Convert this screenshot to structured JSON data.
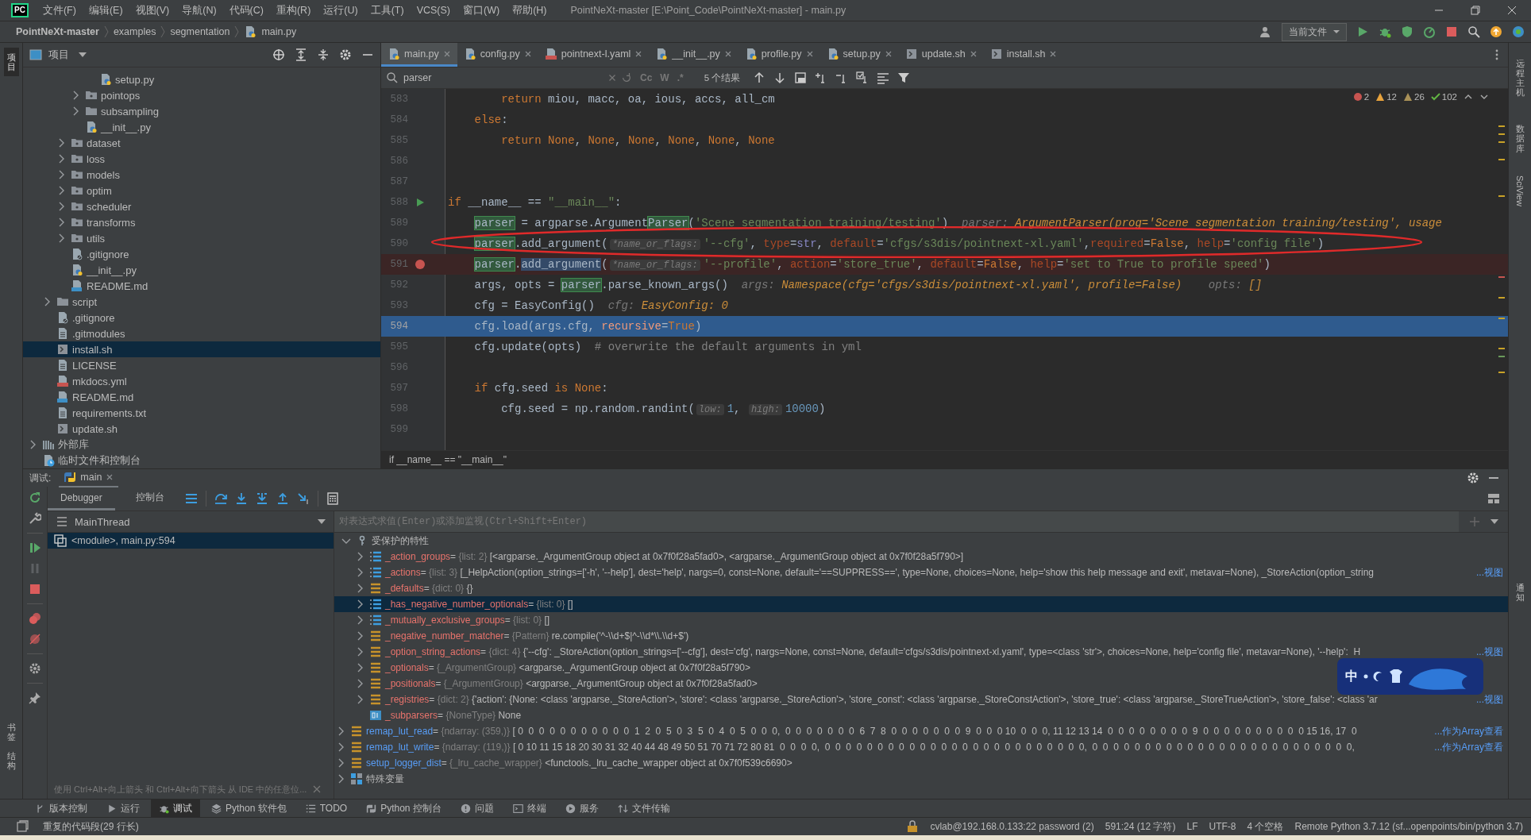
{
  "window": {
    "logo": "PC",
    "title": "PointNeXt-master [E:\\Point_Code\\PointNeXt-master] - main.py"
  },
  "menu": [
    "文件(F)",
    "编辑(E)",
    "视图(V)",
    "导航(N)",
    "代码(C)",
    "重构(R)",
    "运行(U)",
    "工具(T)",
    "VCS(S)",
    "窗口(W)",
    "帮助(H)"
  ],
  "breadcrumb": [
    "PointNeXt-master",
    "examples",
    "segmentation",
    "main.py"
  ],
  "run_config": "当前文件",
  "left_strip": [
    {
      "label": "项目",
      "selected": true
    },
    {
      "label": "书签",
      "selected": false
    },
    {
      "label": "结构",
      "selected": false
    }
  ],
  "right_strip": [
    "远程主机",
    "数据库",
    "SciView",
    "通知"
  ],
  "project": {
    "title": "项目",
    "tree": [
      {
        "children": [
          {
            "children": [
              {
                "children": [
                  {
                    "children": [
                      {
                        "label": "setup.py",
                        "kind": "python",
                        "selected": false
                      }
                    ]
                  },
                  {
                    "label": "pointops",
                    "kind": "package",
                    "expanded": false,
                    "selected": false
                  },
                  {
                    "label": "subsampling",
                    "kind": "folder",
                    "expanded": false,
                    "selected": false
                  },
                  {
                    "label": "__init__.py",
                    "kind": "python",
                    "selected": false
                  }
                ]
              },
              {
                "label": "dataset",
                "kind": "package",
                "expanded": false,
                "selected": false
              },
              {
                "label": "loss",
                "kind": "package",
                "expanded": false,
                "selected": false
              },
              {
                "label": "models",
                "kind": "package",
                "expanded": false,
                "selected": false
              },
              {
                "label": "optim",
                "kind": "package",
                "expanded": false,
                "selected": false
              },
              {
                "label": "scheduler",
                "kind": "package",
                "expanded": false,
                "selected": false
              },
              {
                "label": "transforms",
                "kind": "package",
                "expanded": false,
                "selected": false
              },
              {
                "label": "utils",
                "kind": "package",
                "expanded": false,
                "selected": false
              },
              {
                "label": ".gitignore",
                "kind": "gitignore",
                "selected": false
              },
              {
                "label": "__init__.py",
                "kind": "python",
                "selected": false
              },
              {
                "label": "README.md",
                "kind": "md",
                "selected": false
              }
            ]
          },
          {
            "label": "script",
            "kind": "folder",
            "expanded": false,
            "selected": false
          },
          {
            "label": ".gitignore",
            "kind": "gitignore",
            "selected": false
          },
          {
            "label": ".gitmodules",
            "kind": "file",
            "selected": false
          },
          {
            "label": "install.sh",
            "kind": "sh",
            "selected": true
          },
          {
            "label": "LICENSE",
            "kind": "file",
            "selected": false
          },
          {
            "label": "mkdocs.yml",
            "kind": "yml",
            "selected": false
          },
          {
            "label": "README.md",
            "kind": "md",
            "selected": false
          },
          {
            "label": "requirements.txt",
            "kind": "file",
            "selected": false
          },
          {
            "label": "update.sh",
            "kind": "sh",
            "selected": false
          }
        ]
      },
      {
        "label": "外部库",
        "kind": "lib",
        "expanded": false,
        "selected": false
      },
      {
        "label": "临时文件和控制台",
        "kind": "scratch",
        "selected": false
      }
    ]
  },
  "editor": {
    "tabs": [
      {
        "label": "main.py",
        "kind": "python",
        "selected": true
      },
      {
        "label": "config.py",
        "kind": "python",
        "selected": false
      },
      {
        "label": "pointnext-l.yaml",
        "kind": "yml",
        "selected": false
      },
      {
        "label": "__init__.py",
        "kind": "python",
        "selected": false
      },
      {
        "label": "profile.py",
        "kind": "python",
        "selected": false
      },
      {
        "label": "setup.py",
        "kind": "python",
        "selected": false
      },
      {
        "label": "update.sh",
        "kind": "sh",
        "selected": false
      },
      {
        "label": "install.sh",
        "kind": "sh",
        "selected": false
      }
    ],
    "search": {
      "value": "parser",
      "options": [
        "Cc",
        "W",
        ".*"
      ],
      "results": "5 个结果"
    },
    "inspections": [
      {
        "kind": "error",
        "count": "2"
      },
      {
        "kind": "warning",
        "count": "12"
      },
      {
        "kind": "weak",
        "count": "26"
      },
      {
        "kind": "ok",
        "count": "102"
      }
    ],
    "lines": [
      {
        "number": "583",
        "tokens": [
          {
            "kind": "kw",
            "text": "        return"
          },
          {
            "kind": "p",
            "text": " miou, macc, oa, ious, accs, all_cm"
          }
        ]
      },
      {
        "number": "584",
        "tokens": [
          {
            "kind": "kw",
            "text": "    else"
          },
          {
            "kind": "p",
            "text": ":"
          }
        ]
      },
      {
        "number": "585",
        "tokens": [
          {
            "kind": "kw",
            "text": "        return None"
          },
          {
            "kind": "p",
            "text": ", "
          },
          {
            "kind": "kw",
            "text": "None"
          },
          {
            "kind": "p",
            "text": ", "
          },
          {
            "kind": "kw",
            "text": "None"
          },
          {
            "kind": "p",
            "text": ", "
          },
          {
            "kind": "kw",
            "text": "None"
          },
          {
            "kind": "p",
            "text": ", "
          },
          {
            "kind": "kw",
            "text": "None"
          },
          {
            "kind": "p",
            "text": ", "
          },
          {
            "kind": "kw",
            "text": "None"
          }
        ]
      },
      {
        "number": "586"
      },
      {
        "number": "587"
      },
      {
        "number": "588",
        "run": true,
        "tokens": [
          {
            "kind": "kw",
            "text": "if"
          },
          {
            "kind": "p",
            "text": " __name__ == "
          },
          {
            "kind": "str",
            "text": "\"__main__\""
          },
          {
            "kind": "p",
            "text": ":"
          }
        ]
      },
      {
        "number": "589",
        "tokens": [
          {
            "kind": "match",
            "text": "    parser"
          },
          {
            "kind": "p",
            "text": " = argparse.Argument"
          },
          {
            "kind": "match",
            "text": "Parser"
          },
          {
            "kind": "p",
            "text": "("
          },
          {
            "kind": "str",
            "text": "'Scene segmentation training/testing'"
          },
          {
            "kind": "p",
            "text": ")"
          },
          {
            "kind": "iname",
            "text": "  parser:"
          },
          {
            "kind": "ival",
            "text": " ArgumentParser(prog='Scene segmentation training/testing', usage"
          }
        ]
      },
      {
        "number": "590",
        "tokens": [
          {
            "kind": "match",
            "text": "    parser"
          },
          {
            "kind": "p",
            "text": ".add_argument("
          },
          {
            "kind": "hint",
            "text": "*name_or_flags:"
          },
          {
            "kind": "str",
            "text": "'--cfg'"
          },
          {
            "kind": "p",
            "text": ", "
          },
          {
            "kind": "arg",
            "text": "type"
          },
          {
            "kind": "p",
            "text": "="
          },
          {
            "kind": "bi",
            "text": "str"
          },
          {
            "kind": "p",
            "text": ", "
          },
          {
            "kind": "arg",
            "text": "default"
          },
          {
            "kind": "p",
            "text": "="
          },
          {
            "kind": "str",
            "text": "'cfgs/s3dis/pointnext-xl.yaml'"
          },
          {
            "kind": "p",
            "text": ","
          },
          {
            "kind": "arg",
            "text": "required"
          },
          {
            "kind": "p",
            "text": "="
          },
          {
            "kind": "kw",
            "text": "False"
          },
          {
            "kind": "p",
            "text": ", "
          },
          {
            "kind": "arg",
            "text": "help"
          },
          {
            "kind": "p",
            "text": "="
          },
          {
            "kind": "str",
            "text": "'config file'"
          },
          {
            "kind": "p",
            "text": ")"
          }
        ]
      },
      {
        "number": "591",
        "breakpoint": true,
        "tokens": [
          {
            "kind": "match",
            "text": "    parser"
          },
          {
            "kind": "p",
            "text": "."
          },
          {
            "kind": "ident",
            "text": "add_argument"
          },
          {
            "kind": "p",
            "text": "("
          },
          {
            "kind": "hint",
            "text": "*name_or_flags:"
          },
          {
            "kind": "str",
            "text": "'--profile'"
          },
          {
            "kind": "p",
            "text": ", "
          },
          {
            "kind": "arg",
            "text": "action"
          },
          {
            "kind": "p",
            "text": "="
          },
          {
            "kind": "str",
            "text": "'store_true'"
          },
          {
            "kind": "p",
            "text": ", "
          },
          {
            "kind": "arg",
            "text": "default"
          },
          {
            "kind": "p",
            "text": "="
          },
          {
            "kind": "kw",
            "text": "False"
          },
          {
            "kind": "p",
            "text": ", "
          },
          {
            "kind": "arg",
            "text": "help"
          },
          {
            "kind": "p",
            "text": "="
          },
          {
            "kind": "str",
            "text": "'set to True to profile speed'"
          },
          {
            "kind": "p",
            "text": ")"
          }
        ]
      },
      {
        "number": "592",
        "tokens": [
          {
            "kind": "p",
            "text": "    args, opts = "
          },
          {
            "kind": "match",
            "text": "parser"
          },
          {
            "kind": "p",
            "text": ".parse_known_args()"
          },
          {
            "kind": "iname",
            "text": "  args:"
          },
          {
            "kind": "ival",
            "text": " Namespace(cfg='cfgs/s3dis/pointnext-xl.yaml', profile=False)"
          },
          {
            "kind": "iname",
            "text": "    opts:"
          },
          {
            "kind": "ival",
            "text": " []"
          }
        ]
      },
      {
        "number": "593",
        "tokens": [
          {
            "kind": "p",
            "text": "    cfg = EasyConfig()"
          },
          {
            "kind": "iname",
            "text": "  cfg:"
          },
          {
            "kind": "ival",
            "text": " EasyConfig: 0"
          }
        ]
      },
      {
        "number": "594",
        "current": true,
        "tokens": [
          {
            "kind": "p",
            "text": "    cfg.load(args.cfg, "
          },
          {
            "kind": "arg",
            "text": "recursive"
          },
          {
            "kind": "p",
            "text": "="
          },
          {
            "kind": "kw",
            "text": "True"
          },
          {
            "kind": "p",
            "text": ")"
          }
        ]
      },
      {
        "number": "595",
        "tokens": [
          {
            "kind": "p",
            "text": "    cfg.update(opts)  "
          },
          {
            "kind": "cm",
            "text": "# overwrite the default arguments in yml"
          }
        ]
      },
      {
        "number": "596"
      },
      {
        "number": "597",
        "tokens": [
          {
            "kind": "kw",
            "text": "    if"
          },
          {
            "kind": "p",
            "text": " cfg.seed "
          },
          {
            "kind": "kw",
            "text": "is None"
          },
          {
            "kind": "p",
            "text": ":"
          }
        ]
      },
      {
        "number": "598",
        "tokens": [
          {
            "kind": "p",
            "text": "        cfg.seed = np.random.randint("
          },
          {
            "kind": "hint",
            "text": "low:"
          },
          {
            "kind": "num",
            "text": "1"
          },
          {
            "kind": "p",
            "text": ", "
          },
          {
            "kind": "hint",
            "text": "high:"
          },
          {
            "kind": "num",
            "text": "10000"
          },
          {
            "kind": "p",
            "text": ")"
          }
        ]
      },
      {
        "number": "599"
      }
    ],
    "context": "if __name__ == \"__main__\"",
    "annotation": {
      "kind": "ellipse"
    }
  },
  "debug": {
    "title": "调试:",
    "session": "main",
    "tabs": [
      {
        "label": "Debugger",
        "selected": true
      },
      {
        "label": "控制台",
        "selected": false
      }
    ],
    "thread": "MainThread",
    "frames": [
      {
        "label": "<module>, main.py:594",
        "selected": true
      }
    ],
    "hint": "使用 Ctrl+Alt+向上箭头 和 Ctrl+Alt+向下箭头 从 IDE 中的任意位...",
    "eval_placeholder": "对表达式求值(Enter)或添加监视(Ctrl+Shift+Enter)",
    "variables": [
      {
        "children": [
          {
            "name": "受保护的特性",
            "kind": "key",
            "expanded": true,
            "selected": false,
            "children": [
              {
                "name": "_action_groups",
                "equals": "=",
                "type": "{list: 2}",
                "value": "[<argparse._ArgumentGroup object at 0x7f0f28a5fad0>, <argparse._ArgumentGroup object at 0x7f0f28a5f790>]",
                "kind": "list",
                "expanded": false,
                "selected": false
              },
              {
                "name": "_actions",
                "equals": "=",
                "type": "{list: 3}",
                "value": "[_HelpAction(option_strings=['-h', '--help'], dest='help', nargs=0, const=None, default='==SUPPRESS==', type=None, choices=None, help='show this help message and exit', metavar=None), _StoreAction(option_string",
                "link": "...视图",
                "kind": "list",
                "expanded": false,
                "selected": false
              },
              {
                "name": "_defaults",
                "equals": "=",
                "type": "{dict: 0}",
                "value": "{}",
                "kind": "dict",
                "expanded": false,
                "selected": false
              },
              {
                "name": "_has_negative_number_optionals",
                "equals": "=",
                "type": "{list: 0}",
                "value": "[]",
                "kind": "list",
                "expanded": false,
                "selected": true
              },
              {
                "name": "_mutually_exclusive_groups",
                "equals": "=",
                "type": "{list: 0}",
                "value": "[]",
                "kind": "list",
                "expanded": false,
                "selected": false
              },
              {
                "name": "_negative_number_matcher",
                "equals": "=",
                "type": "{Pattern}",
                "value": "re.compile('^-\\\\d+$|^-\\\\d*\\\\.\\\\d+$')",
                "kind": "dict",
                "expanded": false,
                "selected": false
              },
              {
                "name": "_option_string_actions",
                "equals": "=",
                "type": "{dict: 4}",
                "value": "{'--cfg': _StoreAction(option_strings=['--cfg'], dest='cfg', nargs=None, const=None, default='cfgs/s3dis/pointnext-xl.yaml', type=<class 'str'>, choices=None, help='config file', metavar=None), '--help':  H",
                "link": "...视图",
                "kind": "dict",
                "expanded": false,
                "selected": false
              },
              {
                "name": "_optionals",
                "equals": "=",
                "type": "{_ArgumentGroup}",
                "value": "<argparse._ArgumentGroup object at 0x7f0f28a5f790>",
                "kind": "dict",
                "expanded": false,
                "selected": false
              },
              {
                "name": "_positionals",
                "equals": "=",
                "type": "{_ArgumentGroup}",
                "value": "<argparse._ArgumentGroup object at 0x7f0f28a5fad0>",
                "kind": "dict",
                "expanded": false,
                "selected": false
              },
              {
                "name": "_registries",
                "equals": "=",
                "type": "{dict: 2}",
                "value": "{'action': {None: <class 'argparse._StoreAction'>, 'store': <class 'argparse._StoreAction'>, 'store_const': <class 'argparse._StoreConstAction'>, 'store_true': <class 'argparse._StoreTrueAction'>, 'store_false': <class 'ar",
                "link": "...视图",
                "kind": "dict",
                "expanded": false,
                "selected": false
              },
              {
                "name": "_subparsers",
                "equals": "=",
                "type": "{NoneType}",
                "value": "None",
                "kind": "int",
                "selected": false
              }
            ]
          }
        ]
      },
      {
        "name": "remap_lut_read",
        "equals": "=",
        "type": "{ndarray: (359,)}",
        "value": "[ 0  0  0  0  0  0  0  0  0  0  0  1  2  0  5  0  3  5  0  4  0  5  0  0  0,  0  0  0  0  0  0  0  6  7  8  0  0  0  0  0  0  0  9  0  0  0 10  0  0  0, 11 12 13 14  0  0  0  0  0  0  0  0  9  0  0  0  0  0  0  0  0  0  0 15 16, 17  0",
        "link": "...作为Array查看",
        "kind": "dict",
        "expanded": false,
        "selected": false
      },
      {
        "name": "remap_lut_write",
        "equals": "=",
        "type": "{ndarray: (119,)}",
        "value": "[ 0 10 11 15 18 20 30 31 32 40 44 48 49 50 51 70 71 72 80 81  0  0  0  0,  0  0  0  0  0  0  0  0  0  0  0  0  0  0  0  0  0  0  0  0  0  0  0  0  0,  0  0  0  0  0  0  0  0  0  0  0  0  0  0  0  0  0  0  0  0  0  0  0  0  0,",
        "link": "...作为Array查看",
        "kind": "dict",
        "expanded": false,
        "selected": false
      },
      {
        "name": "setup_logger_dist",
        "equals": "=",
        "type": "{_lru_cache_wrapper}",
        "value": "<functools._lru_cache_wrapper object at 0x7f0f539c6690>",
        "kind": "dict",
        "expanded": false,
        "selected": false
      },
      {
        "name": "特殊变量",
        "kind": "special",
        "expanded": false,
        "selected": false
      }
    ]
  },
  "toolwindows": [
    {
      "label": "版本控制",
      "kind": "vcs",
      "selected": false
    },
    {
      "label": "运行",
      "kind": "run",
      "selected": false
    },
    {
      "label": "调试",
      "kind": "bug",
      "selected": true
    },
    {
      "label": "Python 软件包",
      "kind": "layers",
      "selected": false
    },
    {
      "label": "TODO",
      "kind": "todo",
      "selected": false
    },
    {
      "label": "Python 控制台",
      "kind": "pyconsole",
      "selected": false
    },
    {
      "label": "问题",
      "kind": "problem",
      "selected": false
    },
    {
      "label": "终端",
      "kind": "terminal",
      "selected": false
    },
    {
      "label": "服务",
      "kind": "services",
      "selected": false
    },
    {
      "label": "文件传输",
      "kind": "transfer",
      "selected": false
    }
  ],
  "status": {
    "message": "重复的代码段(29 行长)",
    "items": [
      "cvlab@192.168.0.133:22 password (2)",
      "591:24 (12 字符)",
      "LF",
      "UTF-8",
      "4 个空格",
      "Remote Python 3.7.12 (sf...openpoints/bin/python 3.7)"
    ]
  },
  "ime": {
    "label": "中"
  }
}
